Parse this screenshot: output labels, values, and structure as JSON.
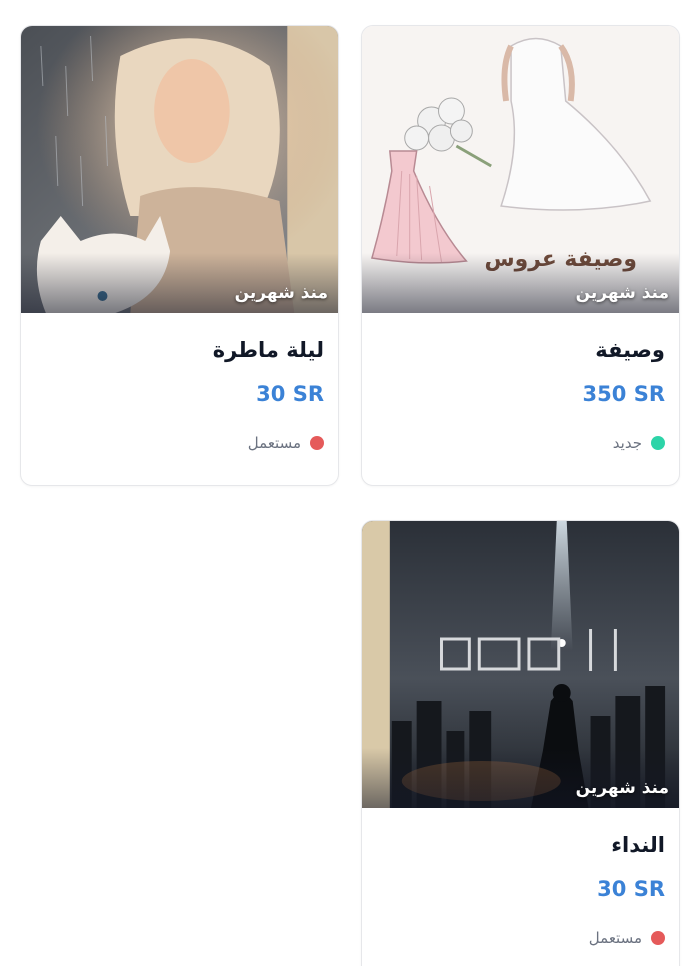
{
  "listings": [
    {
      "title": "وصيفة",
      "price": "350 SR",
      "time": "منذ شهرين",
      "condition": "جديد",
      "condition_color": "#2dd4a8",
      "image_caption": "وصيفة عروس"
    },
    {
      "title": "ليلة ماطرة",
      "price": "30 SR",
      "time": "منذ شهرين",
      "condition": "مستعمل",
      "condition_color": "#e55a5a"
    },
    {
      "title": "النداء",
      "price": "30 SR",
      "time": "منذ شهرين",
      "condition": "مستعمل",
      "condition_color": "#e55a5a"
    }
  ],
  "colors": {
    "price": "#3b82d6",
    "title": "#111827",
    "condition_text": "#6b7280"
  }
}
